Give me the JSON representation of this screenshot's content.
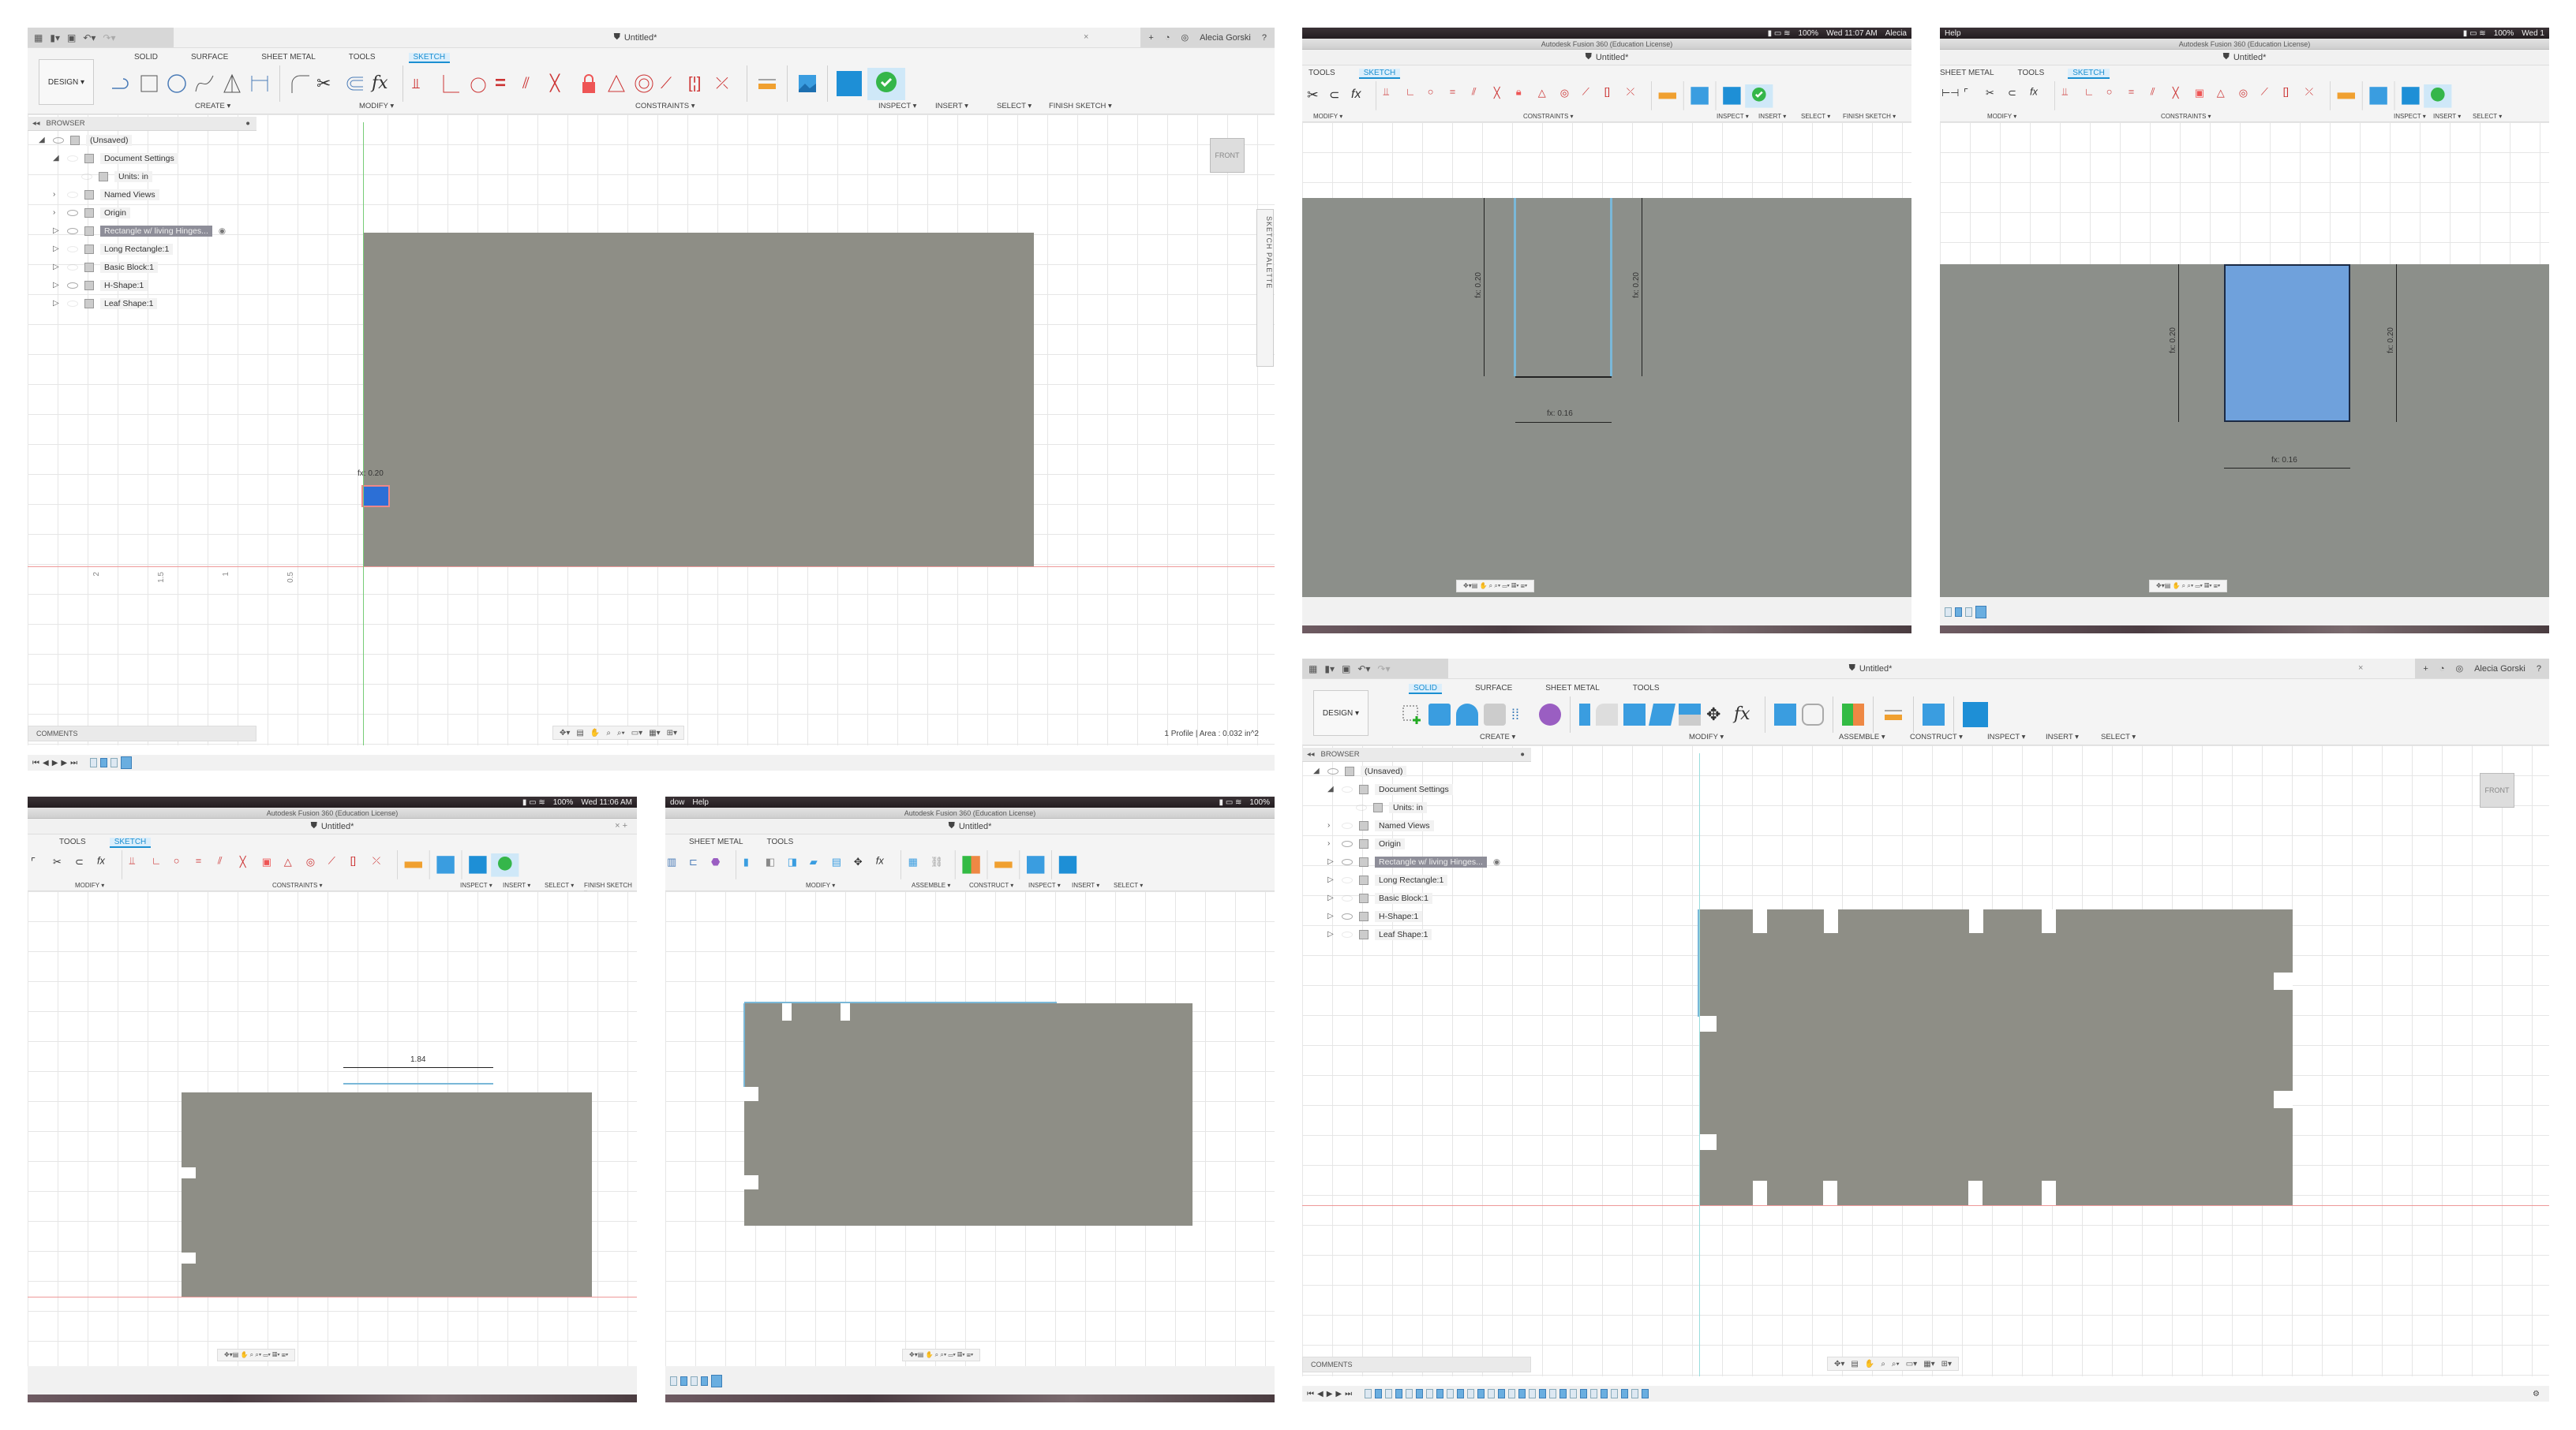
{
  "app": {
    "menubar_title": "Autodesk Fusion 360 (Education License)",
    "doc_title": "Untitled*",
    "user": "Alecia Gorski",
    "battery": "100%",
    "menus": [
      "dow",
      "Help"
    ]
  },
  "ribbon": {
    "workspace": "DESIGN ▾",
    "tabs": [
      "SOLID",
      "SURFACE",
      "SHEET METAL",
      "TOOLS",
      "SKETCH"
    ],
    "sketch_groups": [
      "CREATE ▾",
      "MODIFY ▾",
      "CONSTRAINTS ▾",
      "INSPECT ▾",
      "INSERT ▾",
      "SELECT ▾",
      "FINISH SKETCH ▾"
    ],
    "solid_groups": [
      "CREATE ▾",
      "MODIFY ▾",
      "ASSEMBLE ▾",
      "CONSTRUCT ▾",
      "INSPECT ▾",
      "INSERT ▾",
      "SELECT ▾"
    ]
  },
  "browser": {
    "title": "BROWSER",
    "items": [
      {
        "label": "(Unsaved)",
        "indent": 0,
        "arrow": "◢",
        "eye": true
      },
      {
        "label": "Document Settings",
        "indent": 1,
        "arrow": "◢",
        "eye": false
      },
      {
        "label": "Units: in",
        "indent": 2,
        "arrow": "",
        "eye": false
      },
      {
        "label": "Named Views",
        "indent": 1,
        "arrow": "›",
        "eye": false
      },
      {
        "label": "Origin",
        "indent": 1,
        "arrow": "›",
        "eye": true
      },
      {
        "label": "Rectangle w/ living Hinges...",
        "indent": 1,
        "arrow": "▷",
        "eye": true,
        "selected": true
      },
      {
        "label": "Long Rectangle:1",
        "indent": 1,
        "arrow": "▷",
        "eye": false
      },
      {
        "label": "Basic Block:1",
        "indent": 1,
        "arrow": "▷",
        "eye": false
      },
      {
        "label": "H-Shape:1",
        "indent": 1,
        "arrow": "▷",
        "eye": true
      },
      {
        "label": "Leaf Shape:1",
        "indent": 1,
        "arrow": "▷",
        "eye": false
      }
    ]
  },
  "panels": {
    "p1": {
      "status": "1 Profile | Area : 0.032 in^2",
      "comments": "COMMENTS",
      "viewcube": "FRONT",
      "sketch_palette": "SKETCH PALETTE",
      "dim_label": "fx: 0.20",
      "ruler": [
        "2",
        "1.5",
        "1",
        "0.5"
      ]
    },
    "p2": {
      "clock": "Wed 11:07 AM",
      "user_short": "Alecia",
      "dim_left": "fx: 0.20",
      "dim_right": "fx: 0.20",
      "dim_bottom": "fx: 0.16"
    },
    "p3": {
      "clock": "Wed 1",
      "dim_left": "fx: 0.20",
      "dim_right": "fx: 0.20",
      "dim_bottom": "fx: 0.16"
    },
    "p4": {
      "clock": "Wed 11:06 AM",
      "dim_top": "1.84"
    },
    "p5": {},
    "p6": {
      "comments": "COMMENTS",
      "viewcube": "FRONT"
    }
  }
}
